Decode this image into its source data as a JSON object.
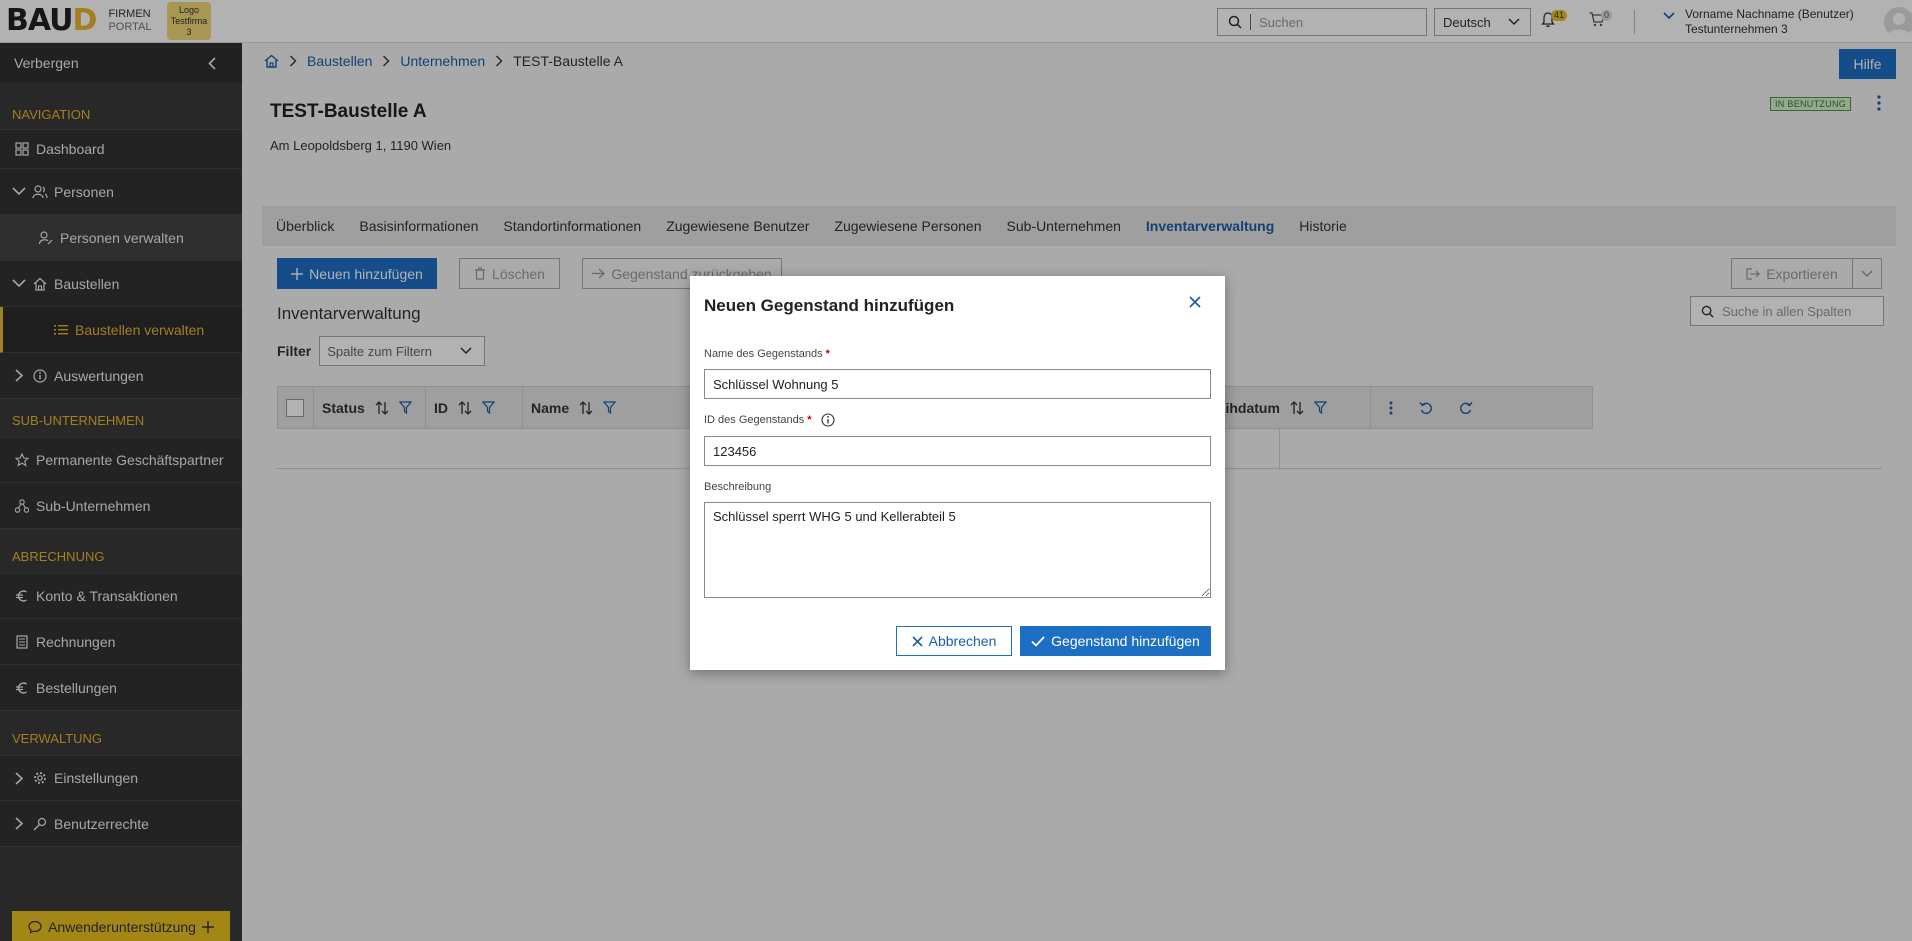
{
  "app": {
    "logo_text_ba": "BA",
    "logo_text_u": "U",
    "logo_text_d": "D",
    "logo_line1": "FIRMEN",
    "logo_line2": "PORTAL",
    "tenant_logo_line1": "Logo",
    "tenant_logo_line2": "Testfirma",
    "tenant_logo_line3": "3"
  },
  "header": {
    "search_placeholder": "Suchen",
    "language": "Deutsch",
    "notification_count": "41",
    "cart_count": "0",
    "user_name": "Vorname Nachname (Benutzer)",
    "user_company": "Testunternehmen 3",
    "help_label": "Hilfe"
  },
  "sidebar": {
    "hide_label": "Verbergen",
    "sections": {
      "navigation": "NAVIGATION",
      "sub_companies": "SUB-UNTERNEHMEN",
      "billing": "ABRECHNUNG",
      "administration": "VERWALTUNG"
    },
    "items": {
      "dashboard": "Dashboard",
      "persons": "Personen",
      "manage_persons": "Personen verwalten",
      "sites": "Baustellen",
      "manage_sites": "Baustellen verwalten",
      "reports": "Auswertungen",
      "permanent_partners": "Permanente Geschäftspartner",
      "sub_companies": "Sub-Unternehmen",
      "account": "Konto & Transaktionen",
      "invoices": "Rechnungen",
      "orders": "Bestellungen",
      "settings": "Einstellungen",
      "user_rights": "Benutzerrechte"
    },
    "support_label": "Anwenderunterstützung"
  },
  "breadcrumb": {
    "sites": "Baustellen",
    "companies": "Unternehmen",
    "current": "TEST-Baustelle A"
  },
  "page": {
    "title": "TEST-Baustelle A",
    "address": "Am Leopoldsberg 1, 1190 Wien",
    "status": "IN BENUTZUNG"
  },
  "tabs": [
    "Überblick",
    "Basisinformationen",
    "Standortinformationen",
    "Zugewiesene Benutzer",
    "Zugewiesene Personen",
    "Sub-Unternehmen",
    "Inventarverwaltung",
    "Historie"
  ],
  "active_tab": "Inventarverwaltung",
  "toolbar": {
    "add_label": "Neuen hinzufügen",
    "delete_label": "Löschen",
    "return_label": "Gegenstand zurückgeben",
    "export_label": "Exportieren"
  },
  "inventory": {
    "section_title": "Inventarverwaltung",
    "filter_label": "Filter",
    "filter_placeholder": "Spalte zum Filtern",
    "search_placeholder": "Suche in allen Spalten",
    "columns": [
      "Status",
      "ID",
      "Name",
      "Verleihdatum"
    ]
  },
  "modal": {
    "title": "Neuen Gegenstand hinzufügen",
    "name_label": "Name des Gegenstands",
    "name_value": "Schlüssel Wohnung 5",
    "id_label": "ID des Gegenstands",
    "id_value": "123456",
    "description_label": "Beschreibung",
    "description_value": "Schlüssel sperrt WHG 5 und Kellerabteil 5",
    "required_mark": "*",
    "cancel_label": "Abbrechen",
    "submit_label": "Gegenstand hinzufügen"
  },
  "colors": {
    "primary": "#1d6fc4",
    "accent_yellow": "#e8b72d",
    "sidebar_bg": "#3a3a3a",
    "status_green": "#2d7a22"
  }
}
